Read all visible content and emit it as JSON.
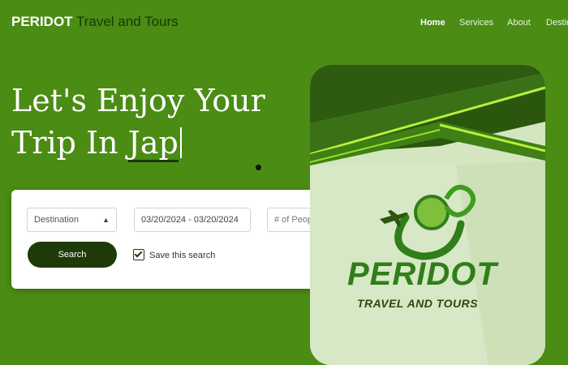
{
  "header": {
    "brand_strong": "PERIDOT",
    "brand_rest": "Travel and Tours",
    "nav": {
      "home": "Home",
      "services": "Services",
      "about": "About",
      "destinations": "Destin"
    }
  },
  "hero": {
    "line1": "Let's Enjoy Your",
    "line2_prefix": "Trip In",
    "line2_typed": "Jap"
  },
  "search": {
    "destination": "Destination",
    "dates": "03/20/2024 - 03/20/2024",
    "people_placeholder": "# of People",
    "button": "Search",
    "save_label": "Save this search",
    "save_checked": true
  },
  "promo": {
    "logo_word": "PERIDOT",
    "logo_sub": "TRAVEL AND TOURS"
  },
  "colors": {
    "background": "#4a8c14",
    "dark_green": "#1e3a08",
    "accent_lime": "#9ae02a"
  }
}
